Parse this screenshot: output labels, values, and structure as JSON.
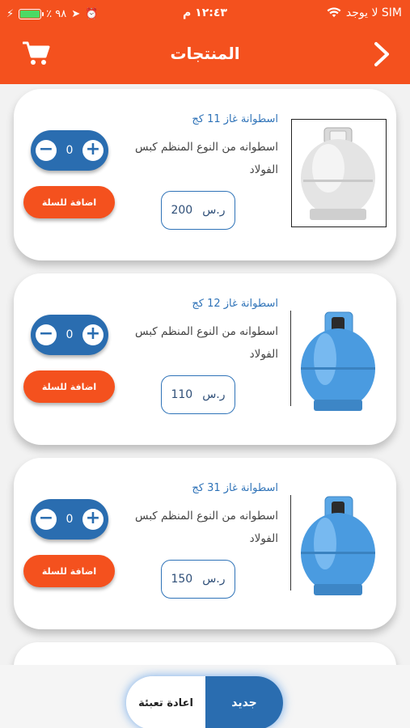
{
  "status_bar": {
    "carrier": "لا يوجد SIM",
    "time": "١٢:٤٣ م",
    "battery_percent": "٪ ٩٨",
    "battery_level": 0.98
  },
  "header": {
    "title": "المنتجات",
    "cart_icon": "cart-icon",
    "back_icon": "chevron-right-icon"
  },
  "products": [
    {
      "title": "اسطوانة غاز 11 كج",
      "description": "اسطوانه من النوع المنظم كبس الفولاد",
      "price": "200",
      "currency": "ر.س",
      "quantity": "0",
      "add_label": "اضافة للسلة",
      "image": "gray-gas-cylinder"
    },
    {
      "title": "اسطوانة غاز 12 كج",
      "description": "اسطوانه من النوع المنظم كبس الفولاد",
      "price": "110",
      "currency": "ر.س",
      "quantity": "0",
      "add_label": "اضافة للسلة",
      "image": "blue-gas-cylinder"
    },
    {
      "title": "اسطوانة غاز 31 كج",
      "description": "اسطوانه من النوع المنظم كبس الفولاد",
      "price": "150",
      "currency": "ر.س",
      "quantity": "0",
      "add_label": "اضافة للسلة",
      "image": "blue-gas-cylinder"
    }
  ],
  "bottom_toggle": {
    "new_label": "جديد",
    "refill_label": "اعادة تعبئة",
    "selected": "جديد"
  },
  "colors": {
    "brand_orange": "#f4511e",
    "brand_blue": "#2a6db0",
    "title_blue": "#2f73b8"
  }
}
